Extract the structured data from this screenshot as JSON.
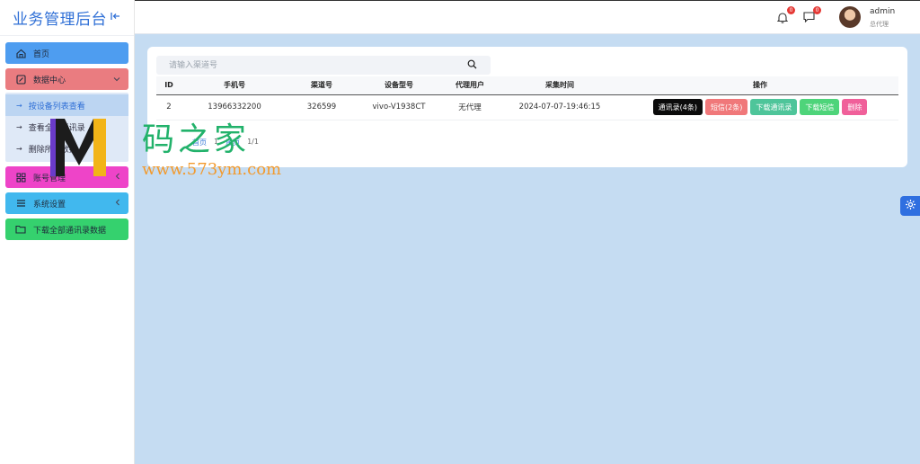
{
  "brand": {
    "title": "业务管理后台",
    "collapse_icon": "collapse-left-icon"
  },
  "sidebar": {
    "items": [
      {
        "label": "首页",
        "icon": "home-icon",
        "color": "#4e9df0"
      },
      {
        "label": "数据中心",
        "icon": "edit-icon",
        "color": "#ea7c80",
        "expanded": true,
        "children": [
          {
            "label": "按设备列表查看",
            "active": true
          },
          {
            "label": "查看全部通讯录"
          },
          {
            "label": "删除所有数据"
          }
        ]
      },
      {
        "label": "账号管理",
        "icon": "grid-icon",
        "color": "#ee44c8"
      },
      {
        "label": "系统设置",
        "icon": "menu-icon",
        "color": "#41b8ee"
      },
      {
        "label": "下载全部通讯录数据",
        "icon": "folder-icon",
        "color": "#35d16e"
      }
    ]
  },
  "topbar": {
    "bell_badge": "0",
    "message_badge": "0",
    "user_name": "admin",
    "user_role": "总代理"
  },
  "search": {
    "placeholder": "请输入渠道号",
    "value": ""
  },
  "table": {
    "columns": [
      "ID",
      "手机号",
      "渠道号",
      "设备型号",
      "代理用户",
      "采集时间",
      "操作"
    ],
    "rows": [
      {
        "id": "2",
        "phone": "13966332200",
        "channel": "326599",
        "device": "vivo-V1938CT",
        "agent": "无代理",
        "time": "2024-07-07-19:46:15",
        "actions": {
          "contacts": "通讯录(4条)",
          "sms": "短信(2条)",
          "download_contacts": "下载通讯录",
          "download_sms": "下载短信",
          "delete": "删除"
        }
      }
    ]
  },
  "pager": {
    "first": "首页",
    "prev": "1",
    "last": "尾页",
    "pages": "1/1"
  },
  "watermark": {
    "text": "码之家",
    "url": "www.573ym.com"
  },
  "colors": {
    "accent": "#2f6fd6",
    "content_bg": "#c5dcf2"
  }
}
